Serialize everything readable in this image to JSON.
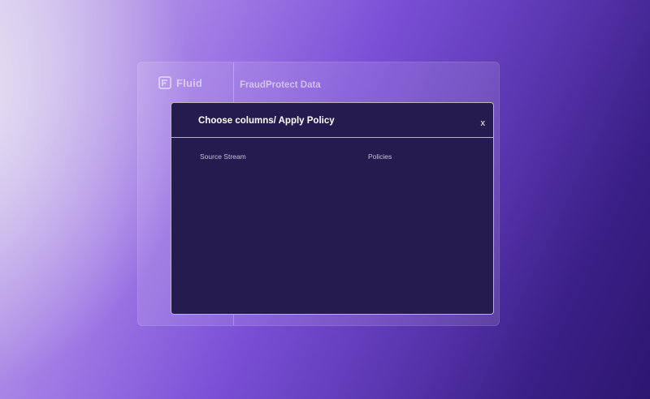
{
  "app": {
    "brand_name": "Fluid",
    "page_title": "FraudProtect Data"
  },
  "modal": {
    "title": "Choose columns/ Apply Policy",
    "close_label": "x",
    "columns": {
      "source_stream": "Source Stream",
      "policies": "Policies"
    }
  },
  "icons": {
    "brand": "fluid-logo-icon",
    "close": "close-icon"
  },
  "colors": {
    "modal_background": "#261b4f",
    "modal_border": "#ebe6fa"
  }
}
